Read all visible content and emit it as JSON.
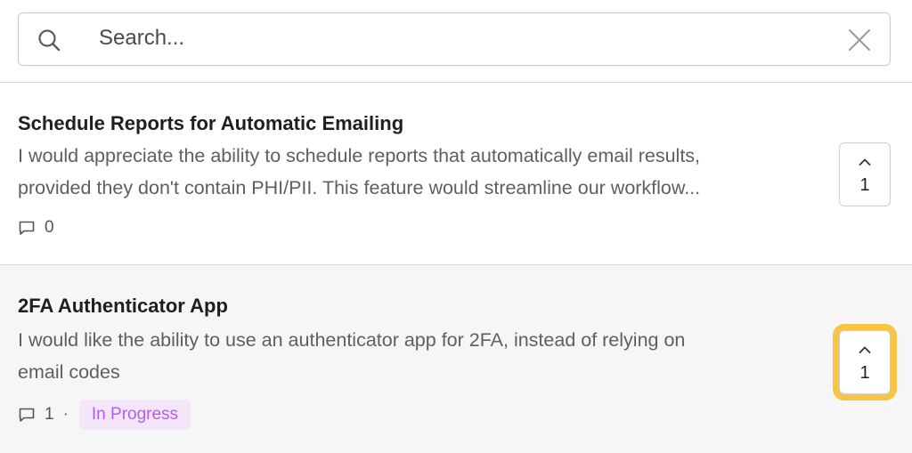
{
  "search": {
    "placeholder": "Search...",
    "icon": "search-icon",
    "clear_icon": "close-icon"
  },
  "posts": [
    {
      "title": "Schedule Reports for Automatic Emailing",
      "description_lines": [
        "I would appreciate the ability to schedule reports that automatically email results,",
        "provided they don't contain PHI/PII. This feature would streamline our workflow..."
      ],
      "comments": "0",
      "votes": "1",
      "status": ""
    },
    {
      "title": "2FA Authenticator App",
      "description_lines": [
        "I would like the ability to use an authenticator app for 2FA, instead of relying on",
        "email codes"
      ],
      "comments": "1",
      "separator": "·",
      "votes": "1",
      "status": "In Progress"
    }
  ],
  "colors": {
    "highlight": "#f7c543",
    "status_bg": "#f3e6fb",
    "status_text": "#b65ee6"
  }
}
